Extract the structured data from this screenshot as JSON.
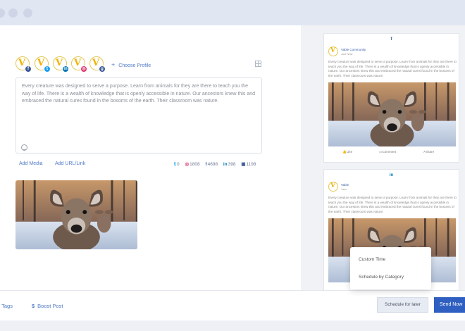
{
  "composer": {
    "profiles": [
      {
        "network": "facebook",
        "icon": "facebook-icon",
        "glyph": "f",
        "color": "#3b5998"
      },
      {
        "network": "twitter",
        "icon": "twitter-icon",
        "glyph": "t",
        "color": "#1da1f2"
      },
      {
        "network": "linkedin",
        "icon": "linkedin-icon",
        "glyph": "in",
        "color": "#0077b5"
      },
      {
        "network": "instagram",
        "icon": "instagram-icon",
        "glyph": "◎",
        "color": "#e1306c"
      },
      {
        "network": "google-business",
        "icon": "google-business-icon",
        "glyph": "g",
        "color": "#3b5998"
      }
    ],
    "choose_profile": "Choose Profile",
    "post_text": "Every creature was designed to serve a purpose. Learn from animals for they are there to teach you the way of life. There is a wealth of knowledge that is openly accessible in nature. Our ancestors knew this and embraced the natural cures found in the bosoms of the earth. Their classroom was nature.",
    "add_media": "Add Media",
    "add_url": "Add URL/Link",
    "counters": [
      {
        "network": "twitter",
        "glyph": "🐦",
        "value": "0",
        "color": "#1da1f2"
      },
      {
        "network": "instagram",
        "glyph": "◎",
        "value": "1808",
        "color": "#e1306c"
      },
      {
        "network": "facebook",
        "glyph": "f",
        "value": "4698",
        "color": "#3b5998"
      },
      {
        "network": "linkedin",
        "glyph": "in",
        "value": "398",
        "color": "#0077b5"
      },
      {
        "network": "google-business",
        "glyph": "▣",
        "value": "1198",
        "color": "#3b5998"
      }
    ]
  },
  "previews": {
    "facebook": {
      "network_label": "f",
      "name": "Vable Community",
      "time": "Just Now",
      "text": "Every creature was designed to serve a purpose. Learn from animals for they are there to teach you the way of life. There is a wealth of knowledge that is openly accessible in nature. Our ancestors knew this and embraced the natural cures found in the bosoms of the earth. Their classroom was nature.",
      "actions": [
        "Like",
        "Comment",
        "Share"
      ]
    },
    "linkedin": {
      "network_label": "in",
      "name": "Vable",
      "time": "1sec",
      "text": "Every creature was designed to serve a purpose. Learn from animals for they are there to teach you the way of life. There is a wealth of knowledge that is openly accessible in nature. Our ancestors knew this and embraced the natural cures found in the bosoms of the earth. Their classroom was nature."
    }
  },
  "footer": {
    "tags": "d Tags",
    "boost_symbol": "$",
    "boost": "Boost Post",
    "schedule": "Schedule for later",
    "send": "Send Now"
  },
  "schedule_menu": {
    "items": [
      "Custom Time",
      "Schedule by Category"
    ]
  }
}
